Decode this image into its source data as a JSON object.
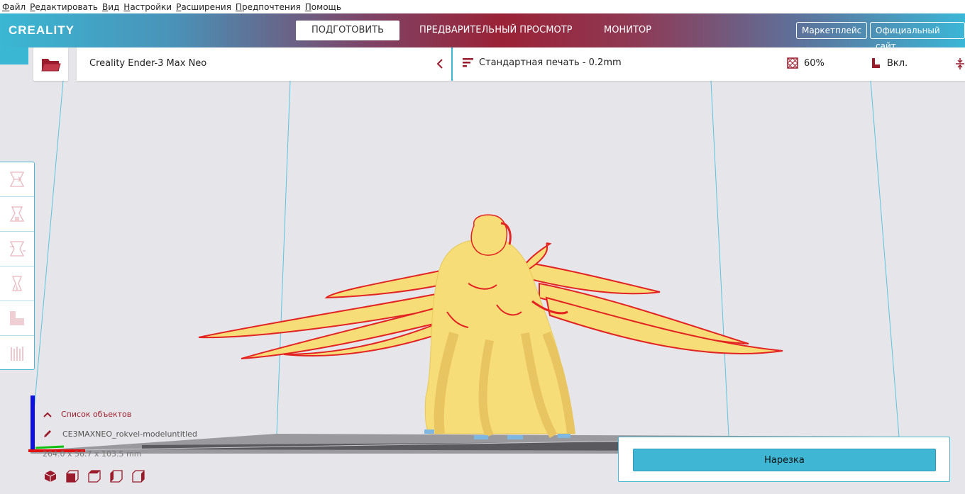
{
  "menu": [
    "Файл",
    "Редактировать",
    "Вид",
    "Настройки",
    "Расширения",
    "Предпочтения",
    "Помощь"
  ],
  "header": {
    "logo": "CREALITY",
    "tabs": [
      "ПОДГОТОВИТЬ",
      "ПРЕДВАРИТЕЛЬНЫЙ ПРОСМОТР",
      "МОНИТОР"
    ],
    "active_tab": "ПОДГОТОВИТЬ",
    "buttons": [
      "Маркетплейс",
      "Официальный сайт"
    ]
  },
  "printer": {
    "name": "Creality Ender-3 Max Neo"
  },
  "settings": {
    "profile": "Стандартная печать - 0.2mm",
    "infill": "60%",
    "support": "Вкл."
  },
  "tools": [
    "move-tool",
    "scale-tool",
    "rotate-tool",
    "mirror-tool",
    "per-model-settings-tool",
    "support-blocker-tool"
  ],
  "objects": {
    "header": "Список объектов",
    "item": "CE3MAXNEO_rokvel-modeluntitled",
    "dimensions": "264.0 x 56.7 x 103.5 mm"
  },
  "slice_button": "Нарезка",
  "colors": {
    "accent": "#3ab7d3",
    "brand_red": "#9a1c2c",
    "model_yellow": "#f6dd78",
    "overhang_red": "#e32222"
  }
}
